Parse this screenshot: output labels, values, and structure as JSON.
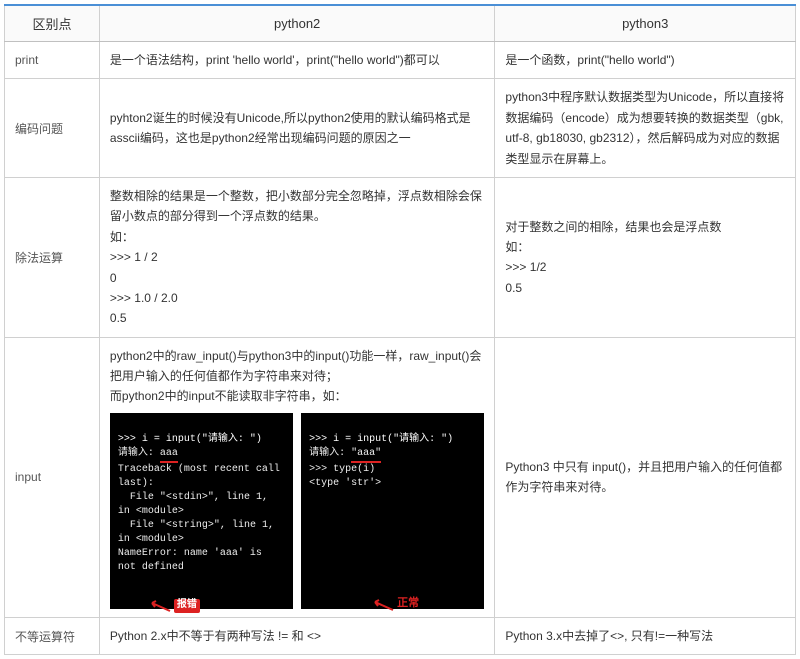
{
  "chart_data": {
    "type": "table",
    "columns": [
      "区别点",
      "python2",
      "python3"
    ],
    "rows": [
      {
        "diff": "print",
        "py2": "是一个语法结构，print 'hello world'，print(\"hello world\")都可以",
        "py3": "是一个函数，print(\"hello world\")"
      },
      {
        "diff": "编码问题",
        "py2": "pyhton2诞生的时候没有Unicode,所以python2使用的默认编码格式是asscii编码，这也是python2经常出现编码问题的原因之一",
        "py3": "python3中程序默认数据类型为Unicode，所以直接将数据编码（encode）成为想要转换的数据类型（gbk, utf-8, gb18030, gb2312），然后解码成为对应的数据类型显示在屏幕上。"
      },
      {
        "diff": "除法运算",
        "py2": "整数相除的结果是一个整数，把小数部分完全忽略掉，浮点数相除会保留小数点的部分得到一个浮点数的结果。\n如：\n>>> 1 / 2\n0\n>>> 1.0 / 2.0\n0.5",
        "py3": "对于整数之间的相除，结果也会是浮点数\n如：\n>>> 1/2\n0.5"
      },
      {
        "diff": "input",
        "py2_intro": "python2中的raw_input()与python3中的input()功能一样，raw_input()会把用户输入的任何值都作为字符串来对待；\n而python2中的input不能读取非字符串，如：",
        "py2_terminal_left": ">>> i = input(\"请输入: \")\n请输入: aaa\nTraceback (most recent call last):\n  File \"<stdin>\", line 1, in <module>\n  File \"<string>\", line 1, in <module>\nNameError: name 'aaa' is not defined",
        "py2_terminal_left_highlight": "aaa",
        "py2_terminal_right": ">>> i = input(\"请输入: \")\n请输入: \"aaa\"\n>>> type(i)\n<type 'str'>",
        "py2_terminal_right_highlight": "\"aaa\"",
        "py2_label_error": "报错",
        "py2_label_ok": "正常",
        "py3": "Python3 中只有 input()，并且把用户输入的任何值都作为字符串来对待。"
      },
      {
        "diff": "不等运算符",
        "py2": "Python 2.x中不等于有两种写法 != 和 <>",
        "py3": "Python 3.x中去掉了<>, 只有!=一种写法"
      }
    ]
  },
  "headers": {
    "diff": "区别点",
    "py2": "python2",
    "py3": "python3"
  }
}
